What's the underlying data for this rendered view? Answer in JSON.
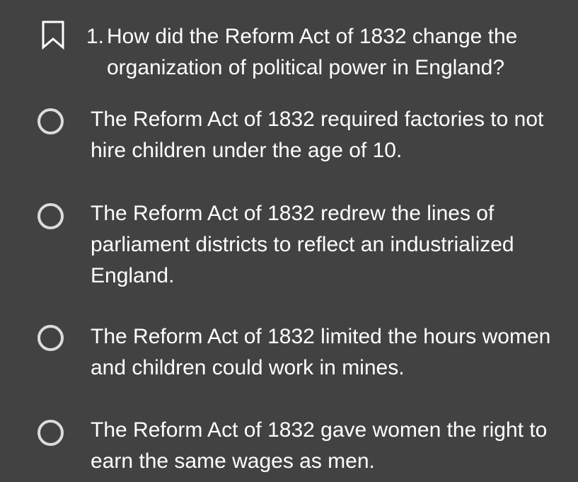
{
  "question": {
    "number": "1.",
    "text": "How did the Reform Act of 1832 change the organization of political power in England?",
    "bookmark_icon": "bookmark-outline-icon"
  },
  "options": [
    {
      "text": "The Reform Act of 1832 required factories to not hire children under the age of 10.",
      "selected": false
    },
    {
      "text": "The Reform Act of 1832 redrew the lines of parliament districts to reflect an industrialized England.",
      "selected": false
    },
    {
      "text": "The Reform Act of 1832 limited the hours women and children could work in mines.",
      "selected": false
    },
    {
      "text": "The Reform Act of 1832 gave women the right to earn the same wages as men.",
      "selected": false
    }
  ],
  "colors": {
    "background": "#424242",
    "text": "#ffffff",
    "radio_border": "#dcdcdc"
  }
}
